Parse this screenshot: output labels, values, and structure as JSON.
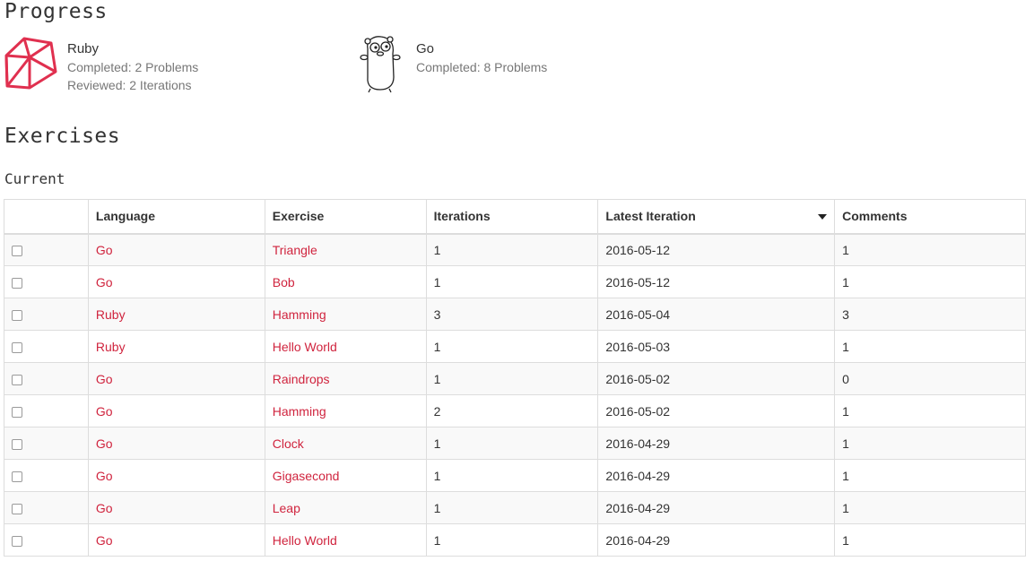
{
  "progress": {
    "title": "Progress",
    "languages": [
      {
        "name": "Ruby",
        "icon": "ruby-icon",
        "completed": "Completed: 2 Problems",
        "reviewed": "Reviewed: 2 Iterations"
      },
      {
        "name": "Go",
        "icon": "gopher-icon",
        "completed": "Completed: 8 Problems"
      }
    ]
  },
  "exercises": {
    "title": "Exercises",
    "current_title": "Current",
    "columns": [
      "",
      "Language",
      "Exercise",
      "Iterations",
      "Latest Iteration",
      "Comments"
    ],
    "rows": [
      {
        "language": "Go",
        "exercise": "Triangle",
        "iterations": "1",
        "latest": "2016-05-12",
        "comments": "1"
      },
      {
        "language": "Go",
        "exercise": "Bob",
        "iterations": "1",
        "latest": "2016-05-12",
        "comments": "1"
      },
      {
        "language": "Ruby",
        "exercise": "Hamming",
        "iterations": "3",
        "latest": "2016-05-04",
        "comments": "3"
      },
      {
        "language": "Ruby",
        "exercise": "Hello World",
        "iterations": "1",
        "latest": "2016-05-03",
        "comments": "1"
      },
      {
        "language": "Go",
        "exercise": "Raindrops",
        "iterations": "1",
        "latest": "2016-05-02",
        "comments": "0"
      },
      {
        "language": "Go",
        "exercise": "Hamming",
        "iterations": "2",
        "latest": "2016-05-02",
        "comments": "1"
      },
      {
        "language": "Go",
        "exercise": "Clock",
        "iterations": "1",
        "latest": "2016-04-29",
        "comments": "1"
      },
      {
        "language": "Go",
        "exercise": "Gigasecond",
        "iterations": "1",
        "latest": "2016-04-29",
        "comments": "1"
      },
      {
        "language": "Go",
        "exercise": "Leap",
        "iterations": "1",
        "latest": "2016-04-29",
        "comments": "1"
      },
      {
        "language": "Go",
        "exercise": "Hello World",
        "iterations": "1",
        "latest": "2016-04-29",
        "comments": "1"
      }
    ]
  },
  "colors": {
    "link": "#d0243e",
    "ruby": "#e0304f",
    "muted": "#777777",
    "border": "#dddddd"
  }
}
